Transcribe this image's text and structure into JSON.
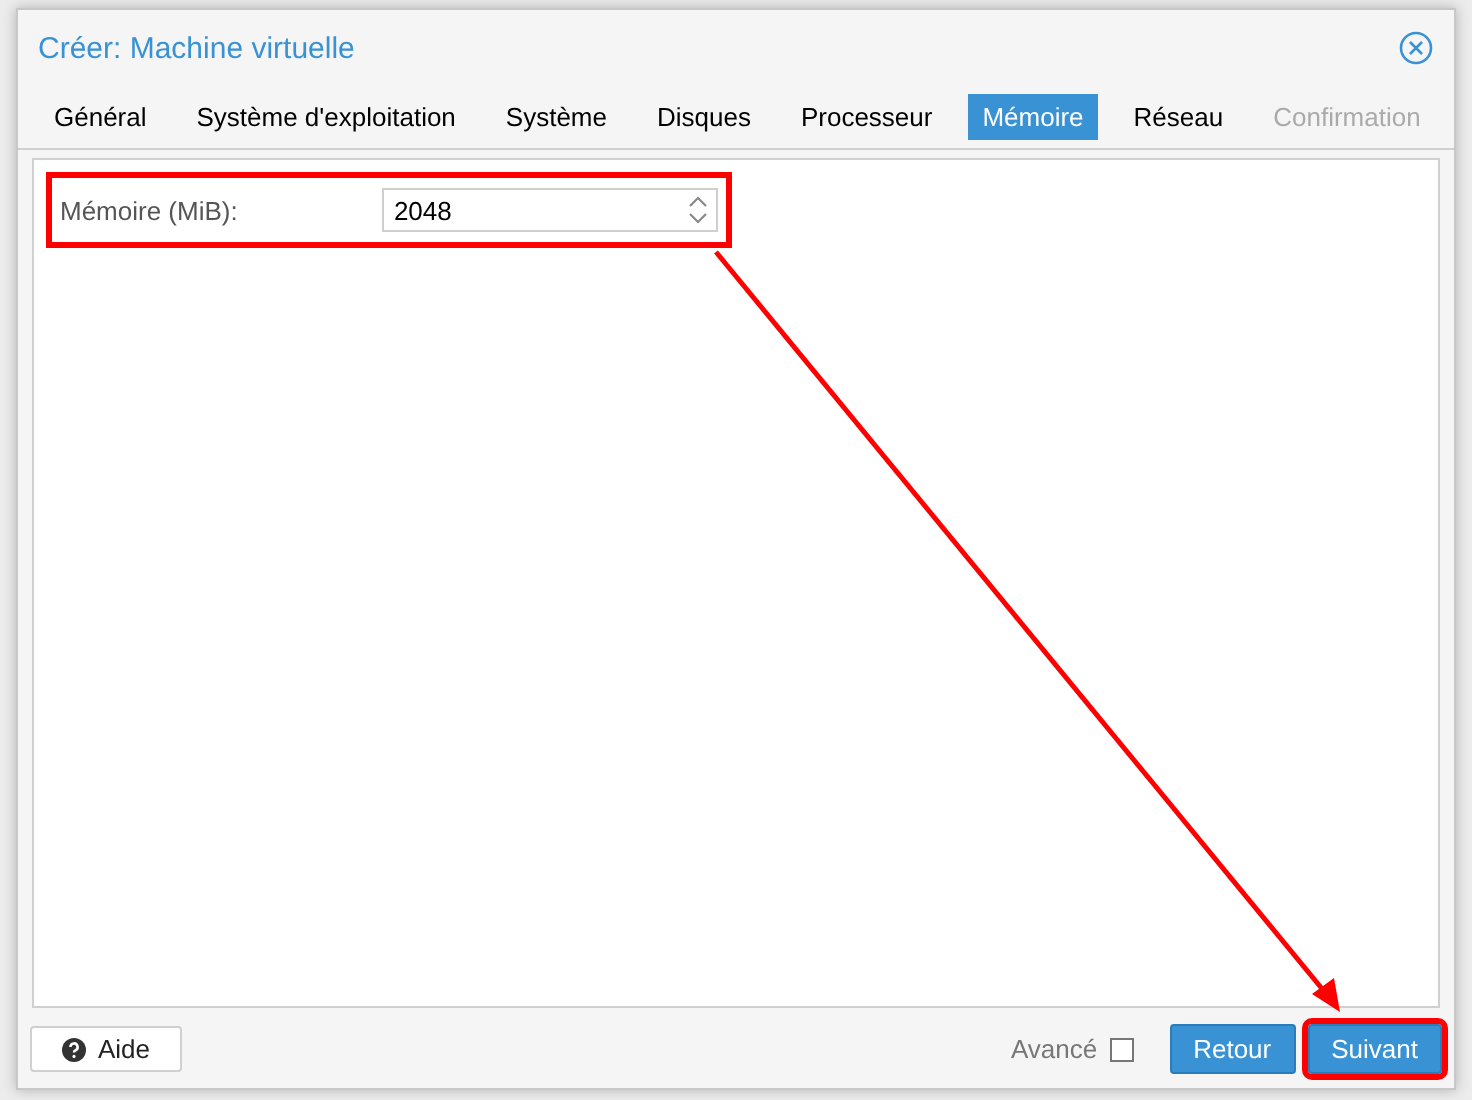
{
  "window": {
    "title": "Créer: Machine virtuelle"
  },
  "tabs": [
    {
      "label": "Général",
      "selected": false,
      "disabled": false
    },
    {
      "label": "Système d'exploitation",
      "selected": false,
      "disabled": false
    },
    {
      "label": "Système",
      "selected": false,
      "disabled": false
    },
    {
      "label": "Disques",
      "selected": false,
      "disabled": false
    },
    {
      "label": "Processeur",
      "selected": false,
      "disabled": false
    },
    {
      "label": "Mémoire",
      "selected": true,
      "disabled": false
    },
    {
      "label": "Réseau",
      "selected": false,
      "disabled": false
    },
    {
      "label": "Confirmation",
      "selected": false,
      "disabled": true
    }
  ],
  "fields": [
    {
      "label": "Mémoire (MiB):",
      "value": "2048",
      "highlighted": true
    }
  ],
  "footer": {
    "help_button": "Aide",
    "advanced": {
      "label": "Avancé",
      "checked": false
    },
    "buttons": [
      {
        "label": "Retour",
        "highlighted": false
      },
      {
        "label": "Suivant",
        "highlighted": true
      }
    ]
  }
}
